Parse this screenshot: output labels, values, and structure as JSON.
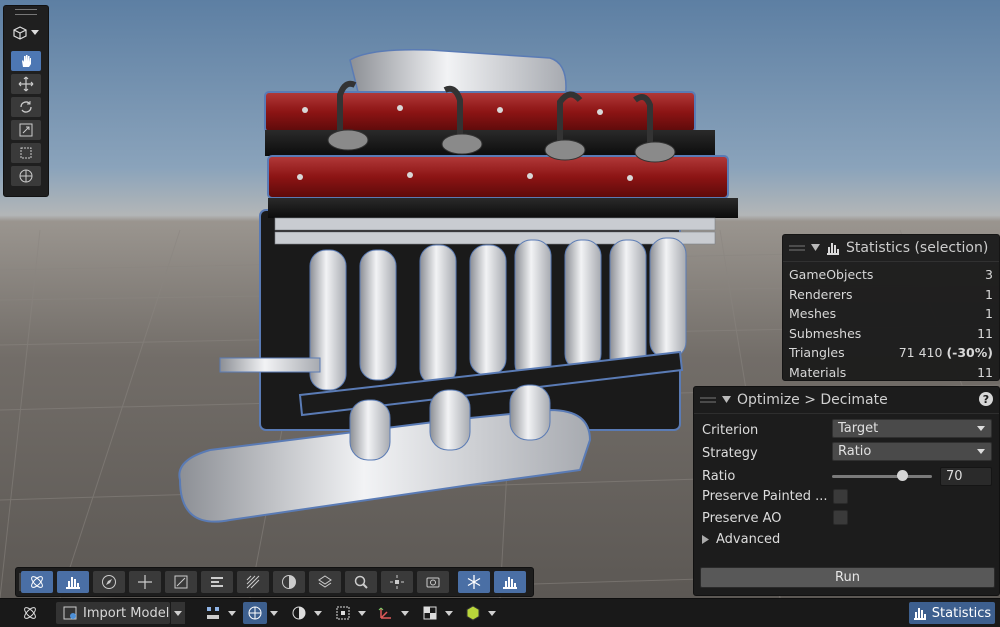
{
  "left_tools": {
    "items": [
      "view-tool",
      "move-tool",
      "rotate-tool",
      "scale-tool",
      "rect-tool",
      "transform-tool"
    ],
    "active": "view-tool"
  },
  "statistics": {
    "title": "Statistics (selection)",
    "rows": [
      {
        "label": "GameObjects",
        "value": "3"
      },
      {
        "label": "Renderers",
        "value": "1"
      },
      {
        "label": "Meshes",
        "value": "1"
      },
      {
        "label": "Submeshes",
        "value": "11"
      },
      {
        "label": "Triangles",
        "value": "71 410",
        "delta": "(-30%)"
      },
      {
        "label": "Materials",
        "value": "11"
      }
    ]
  },
  "optimize": {
    "title": "Optimize > Decimate",
    "help": "?",
    "criterion_label": "Criterion",
    "criterion_value": "Target",
    "strategy_label": "Strategy",
    "strategy_value": "Ratio",
    "ratio_label": "Ratio",
    "ratio_value": "70",
    "ratio_fraction": 0.7,
    "preserve_painted_label": "Preserve Painted ...",
    "preserve_painted_checked": false,
    "preserve_ao_label": "Preserve AO",
    "preserve_ao_checked": false,
    "advanced_label": "Advanced",
    "run_label": "Run"
  },
  "bottom_bar": {
    "import_label": "Import Model",
    "statistics_label": "Statistics"
  },
  "colors": {
    "accent_blue": "#4d77b3",
    "panel_bg": "#1c1c1c"
  }
}
